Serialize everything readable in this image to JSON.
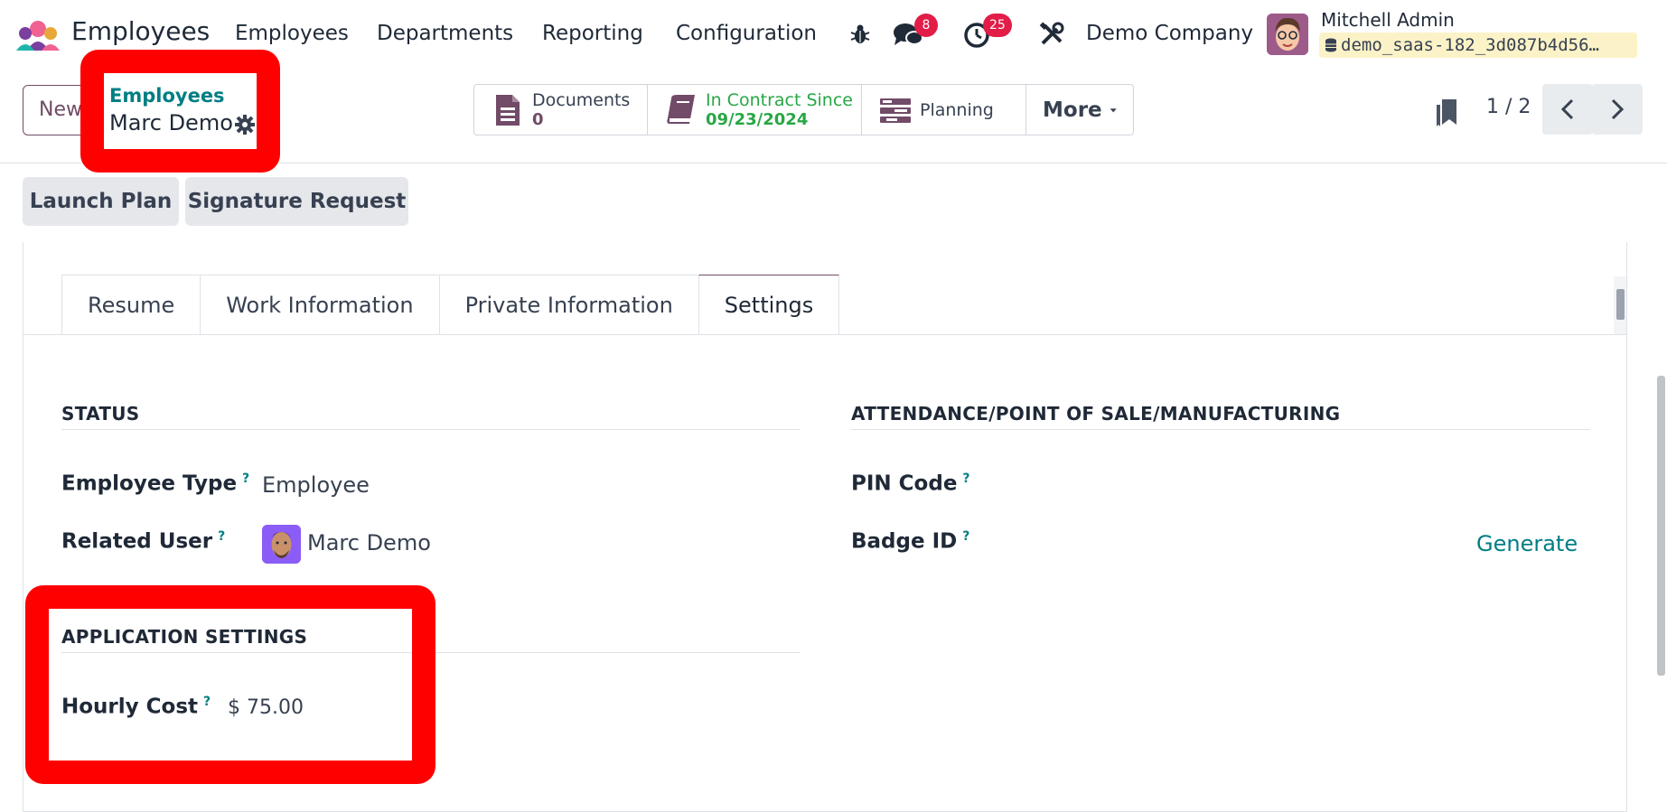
{
  "navbar": {
    "app_name": "Employees",
    "menus": [
      "Employees",
      "Departments",
      "Reporting",
      "Configuration"
    ],
    "messages_count": "8",
    "activities_count": "25",
    "company": "Demo Company",
    "user_name": "Mitchell Admin",
    "database": "demo_saas-182_3d087b4d56…"
  },
  "breadcrumb": {
    "parent": "Employees",
    "current": "Marc Demo"
  },
  "control": {
    "new_label": "New",
    "stats": {
      "documents_label": "Documents",
      "documents_value": "0",
      "contract_label": "In Contract Since",
      "contract_value": "09/23/2024",
      "planning_label": "Planning",
      "more_label": "More"
    },
    "pager": "1 / 2"
  },
  "actions": [
    "Launch Plan",
    "Signature Request"
  ],
  "tabs": [
    "Resume",
    "Work Information",
    "Private Information",
    "Settings"
  ],
  "active_tab": "Settings",
  "status_section": {
    "title": "STATUS",
    "employee_type_label": "Employee Type",
    "employee_type_value": "Employee",
    "related_user_label": "Related User",
    "related_user_value": "Marc Demo"
  },
  "attendance_section": {
    "title": "ATTENDANCE/POINT OF SALE/MANUFACTURING",
    "pin_label": "PIN Code",
    "badge_label": "Badge ID",
    "generate_label": "Generate"
  },
  "app_settings_section": {
    "title": "APPLICATION SETTINGS",
    "hourly_cost_label": "Hourly Cost",
    "hourly_cost_value": "$ 75.00"
  },
  "help_marker": "?",
  "colors": {
    "brand": "#714b67",
    "link": "#017e84",
    "success": "#28a745",
    "badge": "#e11d48",
    "annotation": "#ff0000"
  }
}
